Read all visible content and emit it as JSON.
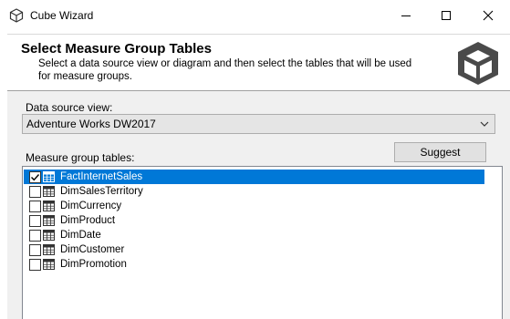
{
  "window": {
    "title": "Cube Wizard",
    "app_icon": "cube-icon",
    "controls": [
      "minimize-icon",
      "maximize-icon",
      "close-icon"
    ]
  },
  "header": {
    "title": "Select Measure Group Tables",
    "description": "Select a data source view or diagram and then select the tables that will be used for measure groups.",
    "logo": "cube-wizard-logo"
  },
  "data_source": {
    "label": "Data source view:",
    "selected": "Adventure Works DW2017"
  },
  "measure_groups": {
    "label": "Measure group tables:",
    "suggest_label": "Suggest",
    "tables": [
      {
        "name": "FactInternetSales",
        "checked": true,
        "selected": true
      },
      {
        "name": "DimSalesTerritory",
        "checked": false,
        "selected": false
      },
      {
        "name": "DimCurrency",
        "checked": false,
        "selected": false
      },
      {
        "name": "DimProduct",
        "checked": false,
        "selected": false
      },
      {
        "name": "DimDate",
        "checked": false,
        "selected": false
      },
      {
        "name": "DimCustomer",
        "checked": false,
        "selected": false
      },
      {
        "name": "DimPromotion",
        "checked": false,
        "selected": false
      }
    ]
  },
  "colors": {
    "selection": "#0078d7",
    "panel_bg": "#f0f0f0"
  }
}
